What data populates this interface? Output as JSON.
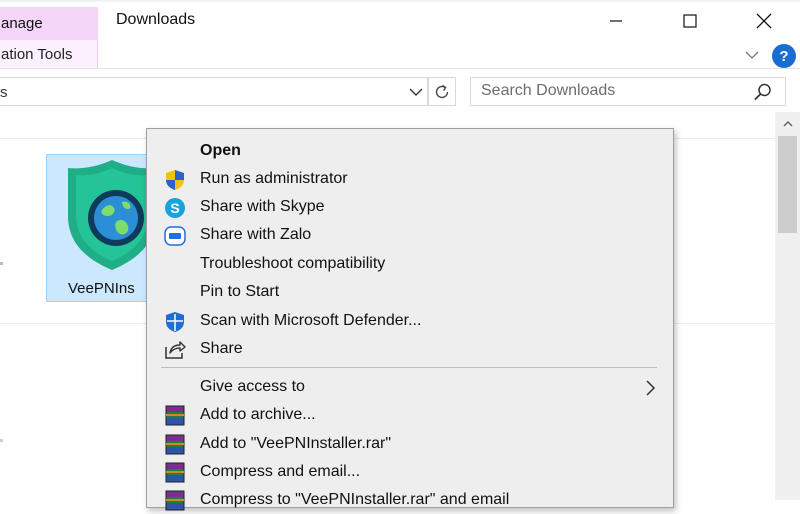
{
  "ribbon": {
    "manage_tab": "anage",
    "app_tools_tab": "ation Tools"
  },
  "window": {
    "title": "Downloads"
  },
  "address_bar": {
    "value": "s"
  },
  "search": {
    "placeholder": "Search Downloads"
  },
  "file": {
    "name": "VeePNIns"
  },
  "context_menu": {
    "items": [
      {
        "label": "Open",
        "icon": "none",
        "bold": true
      },
      {
        "label": "Run as administrator",
        "icon": "uac-shield-icon"
      },
      {
        "label": "Share with Skype",
        "icon": "skype-icon"
      },
      {
        "label": "Share with Zalo",
        "icon": "zalo-icon"
      },
      {
        "label": "Troubleshoot compatibility",
        "icon": "none"
      },
      {
        "label": "Pin to Start",
        "icon": "none"
      },
      {
        "label": "Scan with Microsoft Defender...",
        "icon": "defender-shield-icon"
      },
      {
        "label": "Share",
        "icon": "share-icon"
      },
      {
        "label": "Give access to",
        "icon": "none",
        "submenu": true
      },
      {
        "label": "Add to archive...",
        "icon": "winrar-icon"
      },
      {
        "label": "Add to \"VeePNInstaller.rar\"",
        "icon": "winrar-icon"
      },
      {
        "label": "Compress and email...",
        "icon": "winrar-icon"
      },
      {
        "label": "Compress to \"VeePNInstaller.rar\" and email",
        "icon": "winrar-icon"
      }
    ]
  },
  "colors": {
    "ribbon_manage_bg": "#f3d6f8",
    "selection_bg": "#cce8ff",
    "selection_border": "#99d1ff",
    "menu_bg": "#eeeeee",
    "help_blue": "#1a6dd0",
    "veepn_green": "#1fae86"
  }
}
